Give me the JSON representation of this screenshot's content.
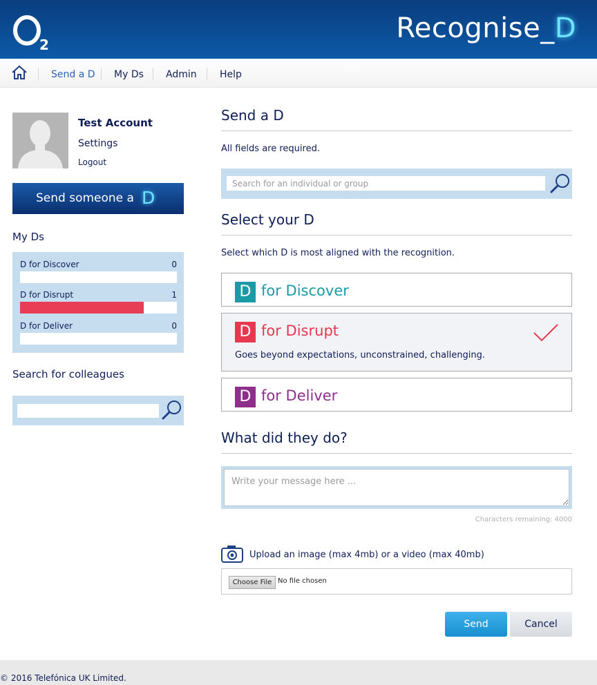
{
  "header": {
    "brand_text": "Recognise_",
    "brand_d": "D"
  },
  "nav": {
    "items": [
      "Send a D",
      "My Ds",
      "Admin",
      "Help"
    ],
    "active": "Send a D"
  },
  "account": {
    "name": "Test Account",
    "settings": "Settings",
    "logout": "Logout"
  },
  "sidebar": {
    "send_banner": "Send someone a",
    "send_banner_d": "D",
    "myds_heading": "My Ds",
    "myds": [
      {
        "label": "D for Discover",
        "count": "0",
        "fill": 0
      },
      {
        "label": "D for Disrupt",
        "count": "1",
        "fill": 1
      },
      {
        "label": "D for Deliver",
        "count": "0",
        "fill": 0
      }
    ],
    "search_heading": "Search for colleagues",
    "search_value": ""
  },
  "main": {
    "send_title": "Send a D",
    "required_note": "All fields are required.",
    "search_placeholder": "Search for an individual or group",
    "select_title": "Select your D",
    "select_note": "Select which D is most aligned with the recognition.",
    "options": [
      {
        "badge": "D",
        "label": "for Discover",
        "color": "#1a9ba8",
        "selected": false,
        "desc": ""
      },
      {
        "badge": "D",
        "label": "for Disrupt",
        "color": "#e8384f",
        "selected": true,
        "desc": "Goes beyond expectations, unconstrained, challenging."
      },
      {
        "badge": "D",
        "label": "for Deliver",
        "color": "#8f2e8b",
        "selected": false,
        "desc": ""
      }
    ],
    "what_title": "What did they do?",
    "message_placeholder": "Write your message here ...",
    "chars_remaining": "Characters remaining: 4000",
    "upload_label": "Upload an image (max 4mb) or a video (max 40mb)",
    "choose_file": "Choose File",
    "file_status": "No file chosen",
    "send": "Send",
    "cancel": "Cancel"
  },
  "footer": {
    "copyright": "© 2016 Telefónica UK Limited."
  },
  "colors": {
    "header_blue": "#0a3d7e",
    "panel_blue": "#c6dcef",
    "navy_text": "#0f1d57",
    "disrupt_red": "#e83d55",
    "send_button": "#1a8fd0"
  }
}
